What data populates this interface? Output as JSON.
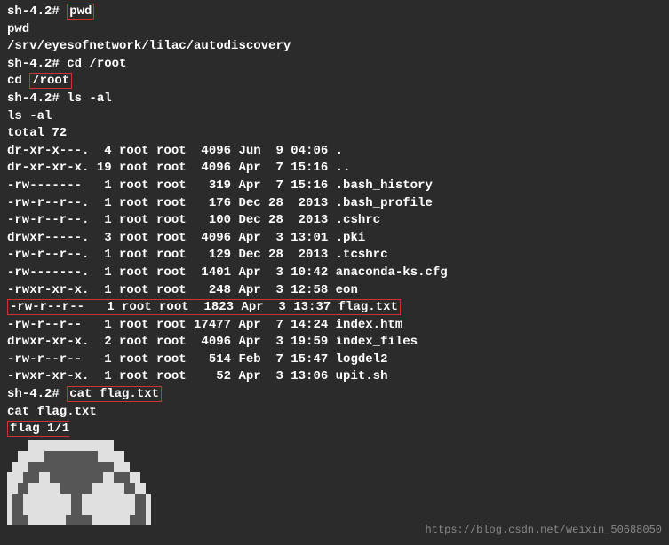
{
  "prompt": "sh-4.2#",
  "cmd1": "pwd",
  "echo1": "pwd",
  "path1": "/srv/eyesofnetwork/lilac/autodiscovery",
  "cmd2_pre": "cd ",
  "cmd2_arg": "/root",
  "echo2_pre": "cd ",
  "echo2_arg": "/root",
  "cmd3": "ls -al",
  "echo3": "ls -al",
  "total_line": "total 72",
  "rows": [
    "dr-xr-x---.  4 root root  4096 Jun  9 04:06 .",
    "dr-xr-xr-x. 19 root root  4096 Apr  7 15:16 ..",
    "-rw-------   1 root root   319 Apr  7 15:16 .bash_history",
    "-rw-r--r--.  1 root root   176 Dec 28  2013 .bash_profile",
    "-rw-r--r--.  1 root root   100 Dec 28  2013 .cshrc",
    "drwxr-----.  3 root root  4096 Apr  3 13:01 .pki",
    "-rw-r--r--.  1 root root   129 Dec 28  2013 .tcshrc",
    "-rw-------.  1 root root  1401 Apr  3 10:42 anaconda-ks.cfg",
    "-rwxr-xr-x.  1 root root   248 Apr  3 12:58 eon"
  ],
  "flag_row": "-rw-r--r--   1 root root  1823 Apr  3 13:37 flag.txt",
  "rows2": [
    "-rw-r--r--   1 root root 17477 Apr  7 14:24 index.htm",
    "drwxr-xr-x.  2 root root  4096 Apr  3 19:59 index_files",
    "-rw-r--r--   1 root root   514 Feb  7 15:47 logdel2",
    "-rwxr-xr-x.  1 root root    52 Apr  3 13:06 upit.sh"
  ],
  "cmd4": "cat flag.txt",
  "echo4": "cat flag.txt",
  "flag_header": "flag 1/1",
  "watermark": "https://blog.csdn.net/weixin_50688050",
  "art": [
    "bbbbwwwwwwwwwwwwwwwwbbbbbbbbbbbbb",
    "bbwwwwwggggggggggwwwwwbbbbbbbbbbb",
    "bwwwggggggggggggggggwwwbbbbbbbbbb",
    "wwwgggwwggggggggggwwgggwwbbbbbbbb",
    "wwggwwwwwwggggggwwwwwwggwwbbbbbbb",
    "wggwwwwwwwwwggwwwwwwwwwwggwbbbbbb",
    "wggwwwwwwwwwggwwwwwwwwwwggwbbbbbb",
    "wgggwwwwwwwgggggwwwwwwwgggwbbbbbb"
  ]
}
